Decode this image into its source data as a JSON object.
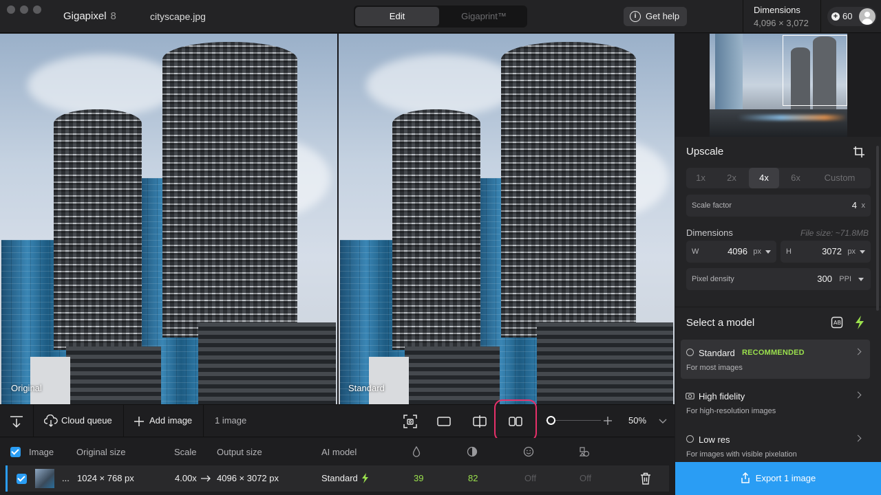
{
  "titlebar": {
    "app_name": "Gigapixel",
    "app_version": "8",
    "file_name": "cityscape.jpg",
    "modes": [
      "Edit",
      "Gigaprint™"
    ],
    "active_mode": "Edit",
    "help_label": "Get help",
    "dimensions_label": "Dimensions",
    "dimensions_value": "4,096 × 3,072",
    "credits": "60"
  },
  "preview": {
    "left_label": "Original",
    "right_label": "Standard"
  },
  "upscale": {
    "title": "Upscale",
    "scale_options": [
      "1x",
      "2x",
      "4x",
      "6x",
      "Custom"
    ],
    "active_scale": "4x",
    "scale_factor_label": "Scale factor",
    "scale_factor_value": "4",
    "scale_factor_unit": "x",
    "dimensions_label": "Dimensions",
    "file_size": "File size: ~71.8MB",
    "width_label": "W",
    "width_value": "4096",
    "width_unit": "px",
    "height_label": "H",
    "height_value": "3072",
    "height_unit": "px",
    "density_label": "Pixel density",
    "density_value": "300",
    "density_unit": "PPI"
  },
  "models": {
    "title": "Select a model",
    "items": [
      {
        "name": "Standard",
        "badge": "RECOMMENDED",
        "desc": "For most images",
        "icon": "globe-icon"
      },
      {
        "name": "High fidelity",
        "badge": "",
        "desc": "For high-resolution images",
        "icon": "camera-icon"
      },
      {
        "name": "Low res",
        "badge": "",
        "desc": "For images with visible pixelation",
        "icon": "globe-icon"
      }
    ]
  },
  "export": {
    "label": "Export 1 image"
  },
  "toolbar": {
    "cloud_queue": "Cloud queue",
    "add_image": "Add image",
    "image_count": "1 image",
    "zoom": "50%"
  },
  "table": {
    "headers": {
      "image": "Image",
      "original_size": "Original size",
      "scale": "Scale",
      "output_size": "Output size",
      "ai_model": "AI model"
    },
    "row": {
      "name": "...",
      "original_size": "1024 × 768 px",
      "scale": "4.00x",
      "output_size": "4096 × 3072 px",
      "ai_model": "Standard",
      "col1": "39",
      "col2": "82",
      "col3": "Off",
      "col4": "Off"
    }
  },
  "colors": {
    "accent": "#2a9df4",
    "recommended": "#9be14d",
    "highlight": "#e8306a"
  }
}
